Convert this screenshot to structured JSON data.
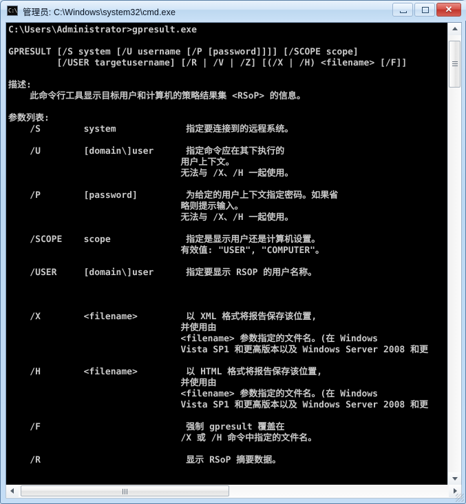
{
  "window": {
    "title": "管理员: C:\\Windows\\system32\\cmd.exe",
    "icon_text": "C:\\",
    "icon_name": "cmd-console-icon",
    "buttons": {
      "minimize": "最小化",
      "maximize": "最大化",
      "close": "✕"
    },
    "colors": {
      "titlebar": "#cfe2f7",
      "frame_border": "#5a7fa6",
      "close_button": "#c0352c",
      "console_background": "#000000",
      "console_foreground": "#c8c8c8"
    }
  },
  "console": {
    "prompt_line": "C:\\Users\\Administrator>gpresult.exe",
    "command": "gpresult.exe",
    "text": "C:\\Users\\Administrator>gpresult.exe\n\nGPRESULT [/S system [/U username [/P [password]]]] [/SCOPE scope]\n         [/USER targetusername] [/R | /V | /Z] [(/X | /H) <filename> [/F]]\n\n描述:\n    此命令行工具显示目标用户和计算机的策略结果集 <RSoP> 的信息。\n\n参数列表:\n    /S        system             指定要连接到的远程系统。\n\n    /U        [domain\\]user      指定命令应在其下执行的\n                                用户上下文。\n                                无法与 /X、/H 一起使用。\n\n    /P        [password]         为给定的用户上下文指定密码。如果省\n                                略则提示输入。\n                                无法与 /X、/H 一起使用。\n\n    /SCOPE    scope              指定是显示用户还是计算机设置。\n                                有效值: \"USER\", \"COMPUTER\"。\n\n    /USER     [domain\\]user      指定要显示 RSOP 的用户名称。\n\n\n\n    /X        <filename>         以 XML 格式将报告保存该位置,\n                                并使用由\n                                <filename> 参数指定的文件名。(在 Windows\n                                Vista SP1 和更高版本以及 Windows Server 2008 和更\n\n    /H        <filename>         以 HTML 格式将报告保存该位置,\n                                并使用由\n                                <filename> 参数指定的文件名。(在 Windows\n                                Vista SP1 和更高版本以及 Windows Server 2008 和更\n\n    /F                           强制 gpresult 覆盖在\n                                /X 或 /H 命令中指定的文件名。\n\n    /R                           显示 RSoP 摘要数据。",
    "sections": {
      "usage_heading": "GPRESULT",
      "description_heading": "描述:",
      "description_body": "此命令行工具显示目标用户和计算机的策略结果集 <RSoP> 的信息。",
      "params_heading": "参数列表:"
    },
    "usage_lines": [
      "GPRESULT [/S system [/U username [/P [password]]]] [/SCOPE scope]",
      "         [/USER targetusername] [/R | /V | /Z] [(/X | /H) <filename> [/F]]"
    ],
    "parameters": [
      {
        "flag": "/S",
        "arg": "system",
        "desc": [
          "指定要连接到的远程系统。"
        ]
      },
      {
        "flag": "/U",
        "arg": "[domain\\]user",
        "desc": [
          "指定命令应在其下执行的",
          "用户上下文。",
          "无法与 /X、/H 一起使用。"
        ]
      },
      {
        "flag": "/P",
        "arg": "[password]",
        "desc": [
          "为给定的用户上下文指定密码。如果省",
          "略则提示输入。",
          "无法与 /X、/H 一起使用。"
        ]
      },
      {
        "flag": "/SCOPE",
        "arg": "scope",
        "desc": [
          "指定是显示用户还是计算机设置。",
          "有效值: \"USER\", \"COMPUTER\"。"
        ]
      },
      {
        "flag": "/USER",
        "arg": "[domain\\]user",
        "desc": [
          "指定要显示 RSOP 的用户名称。"
        ]
      },
      {
        "flag": "/X",
        "arg": "<filename>",
        "desc": [
          "以 XML 格式将报告保存该位置,",
          "并使用由",
          "<filename> 参数指定的文件名。(在 Windows",
          "Vista SP1 和更高版本以及 Windows Server 2008 和更"
        ]
      },
      {
        "flag": "/H",
        "arg": "<filename>",
        "desc": [
          "以 HTML 格式将报告保存该位置,",
          "并使用由",
          "<filename> 参数指定的文件名。(在 Windows",
          "Vista SP1 和更高版本以及 Windows Server 2008 和更"
        ]
      },
      {
        "flag": "/F",
        "arg": "",
        "desc": [
          "强制 gpresult 覆盖在",
          "/X 或 /H 命令中指定的文件名。"
        ]
      },
      {
        "flag": "/R",
        "arg": "",
        "desc": [
          "显示 RSoP 摘要数据。"
        ]
      }
    ]
  },
  "scrollbars": {
    "vertical": {
      "up_icon": "triangle-up-icon",
      "down_icon": "triangle-down-icon",
      "thumb": "vertical-scroll-thumb"
    },
    "horizontal": {
      "left_icon": "triangle-left-icon",
      "right_icon": "triangle-right-icon",
      "thumb": "horizontal-scroll-thumb"
    }
  }
}
